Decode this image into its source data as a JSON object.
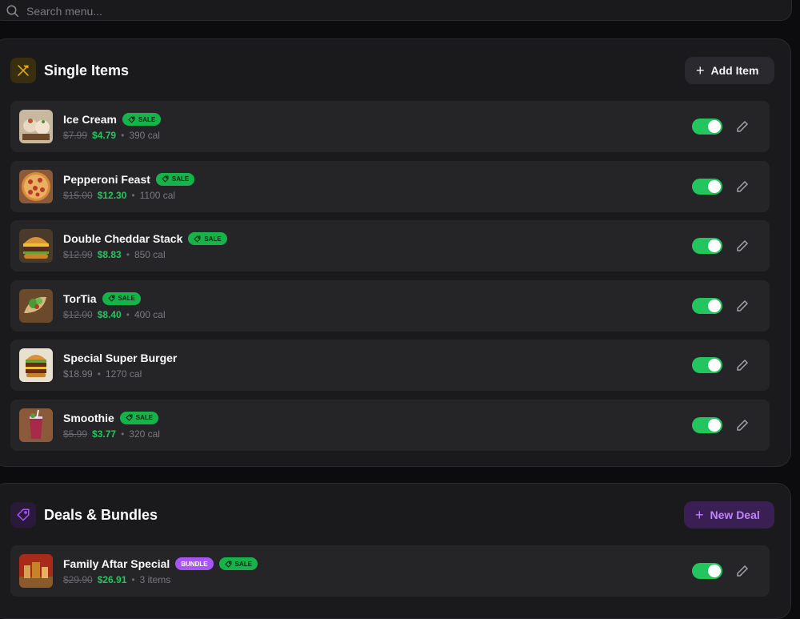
{
  "search": {
    "placeholder": "Search menu..."
  },
  "single_section": {
    "title": "Single Items",
    "add_button": "Add Item",
    "items": [
      {
        "name": "Ice Cream",
        "badge": "SALE",
        "old_price": "$7.99",
        "price": "$4.79",
        "meta": "390 cal",
        "enabled": true,
        "image": "ice-cream-photo"
      },
      {
        "name": "Pepperoni Feast",
        "badge": "SALE",
        "old_price": "$15.00",
        "price": "$12.30",
        "meta": "1100 cal",
        "enabled": true,
        "image": "pizza-photo"
      },
      {
        "name": "Double Cheddar Stack",
        "badge": "SALE",
        "old_price": "$12.99",
        "price": "$8.83",
        "meta": "850 cal",
        "enabled": true,
        "image": "burger-photo"
      },
      {
        "name": "TorTia",
        "badge": "SALE",
        "old_price": "$12.00",
        "price": "$8.40",
        "meta": "400 cal",
        "enabled": true,
        "image": "wrap-photo"
      },
      {
        "name": "Special Super Burger",
        "price": "$18.99",
        "meta": "1270 cal",
        "enabled": true,
        "image": "super-burger-photo"
      },
      {
        "name": "Smoothie",
        "badge": "SALE",
        "old_price": "$5.99",
        "price": "$3.77",
        "meta": "320 cal",
        "enabled": true,
        "image": "smoothie-photo"
      }
    ]
  },
  "deals_section": {
    "title": "Deals & Bundles",
    "add_button": "New Deal",
    "items": [
      {
        "name": "Family Aftar Special",
        "badge_bundle": "BUNDLE",
        "badge": "SALE",
        "old_price": "$29.90",
        "price": "$26.91",
        "meta": "3 items",
        "enabled": true,
        "image": "family-meal-photo"
      }
    ]
  },
  "colors": {
    "accent_green": "#22c55e",
    "bundle_purple": "#a855f7",
    "single_icon": "#eab308",
    "deals_icon": "#a855f7"
  }
}
